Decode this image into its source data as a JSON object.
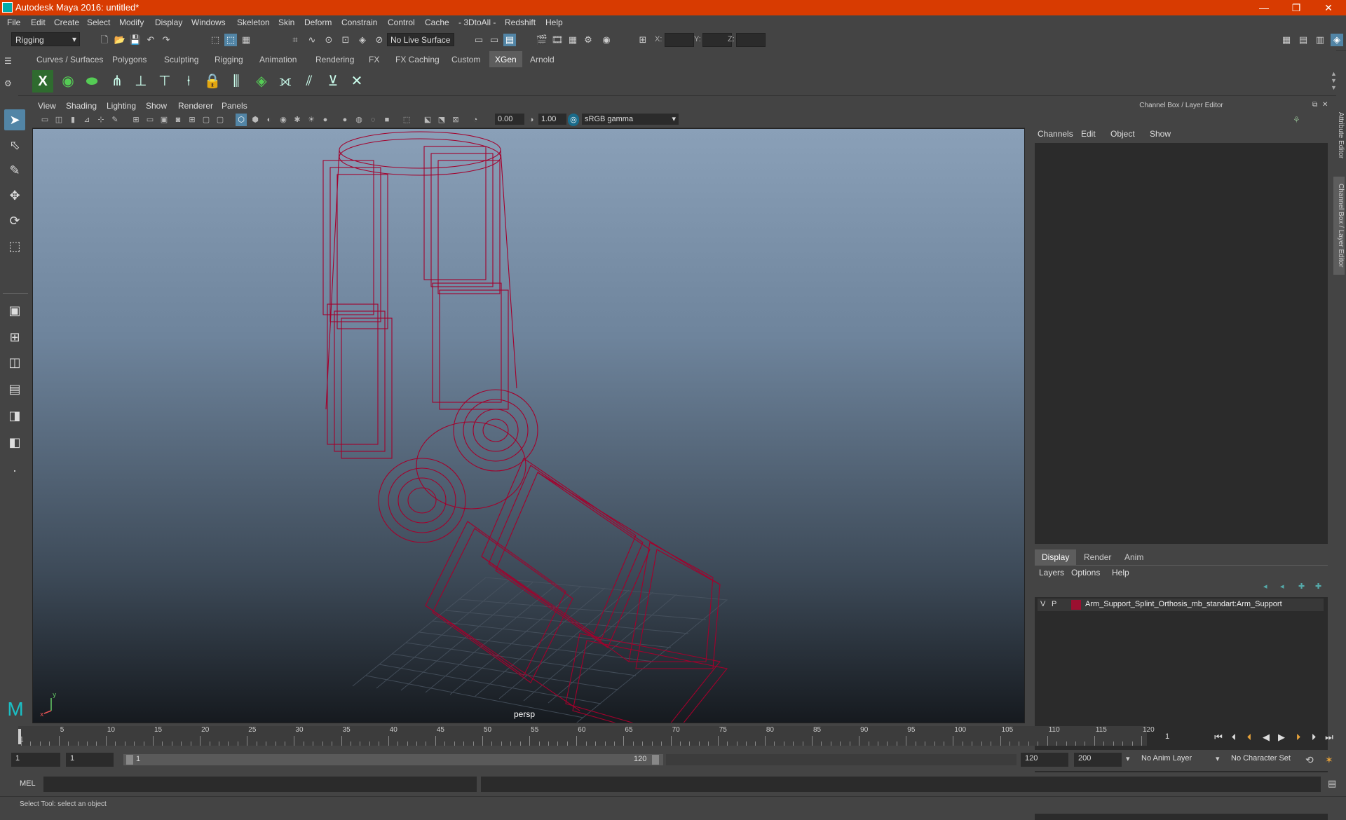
{
  "window": {
    "title": "Autodesk Maya 2016: untitled*",
    "controls": {
      "minimize": "—",
      "restore": "❐",
      "close": "✕"
    }
  },
  "menubar": [
    "File",
    "Edit",
    "Create",
    "Select",
    "Modify",
    "Display",
    "Windows",
    "Skeleton",
    "Skin",
    "Deform",
    "Constrain",
    "Control",
    "Cache",
    "- 3DtoAll -",
    "Redshift",
    "Help"
  ],
  "statusline": {
    "menuset": "Rigging",
    "live_surface": "No Live Surface",
    "coord_labels": {
      "x": "X:",
      "y": "Y:",
      "z": "Z:"
    }
  },
  "shelf": {
    "tabs": [
      "Curves / Surfaces",
      "Polygons",
      "Sculpting",
      "Rigging",
      "Animation",
      "Rendering",
      "FX",
      "FX Caching",
      "Custom",
      "XGen",
      "Arnold"
    ],
    "active_tab": "XGen"
  },
  "viewport": {
    "menus": [
      "View",
      "Shading",
      "Lighting",
      "Show",
      "Renderer",
      "Panels"
    ],
    "exposure": "0.00",
    "gamma": "1.00",
    "color_space": "sRGB gamma",
    "camera": "persp",
    "axis": {
      "x": "x",
      "y": "y"
    }
  },
  "channelbox": {
    "title": "Channel Box / Layer Editor",
    "menus": [
      "Channels",
      "Edit",
      "Object",
      "Show"
    ]
  },
  "layereditor": {
    "tabs": [
      "Display",
      "Render",
      "Anim"
    ],
    "active_tab": "Display",
    "menus": [
      "Layers",
      "Options",
      "Help"
    ],
    "layers": [
      {
        "v": "V",
        "p": "P",
        "color": "#9b1030",
        "name": "Arm_Support_Splint_Orthosis_mb_standart:Arm_Support"
      }
    ]
  },
  "sidetabs": [
    "Attribute Editor",
    "Channel Box / Layer Editor"
  ],
  "timeslider": {
    "start_label": "1",
    "ticks": [
      "5",
      "10",
      "15",
      "20",
      "25",
      "30",
      "35",
      "40",
      "45",
      "50",
      "55",
      "60",
      "65",
      "70",
      "75",
      "80",
      "85",
      "90",
      "95",
      "100",
      "105",
      "110",
      "115",
      "120"
    ],
    "current_frame": "1"
  },
  "rangeslider": {
    "start": "1",
    "playback_start": "1",
    "range_start": "1",
    "range_end": "120",
    "playback_end": "120",
    "end": "200",
    "anim_layer": "No Anim Layer",
    "character_set": "No Character Set"
  },
  "commandline": {
    "label": "MEL"
  },
  "helpline": {
    "text": "Select Tool: select an object"
  },
  "colors": {
    "wire": "#a3002c",
    "accent": "#5285a6",
    "titlebar": "#d83b01"
  }
}
